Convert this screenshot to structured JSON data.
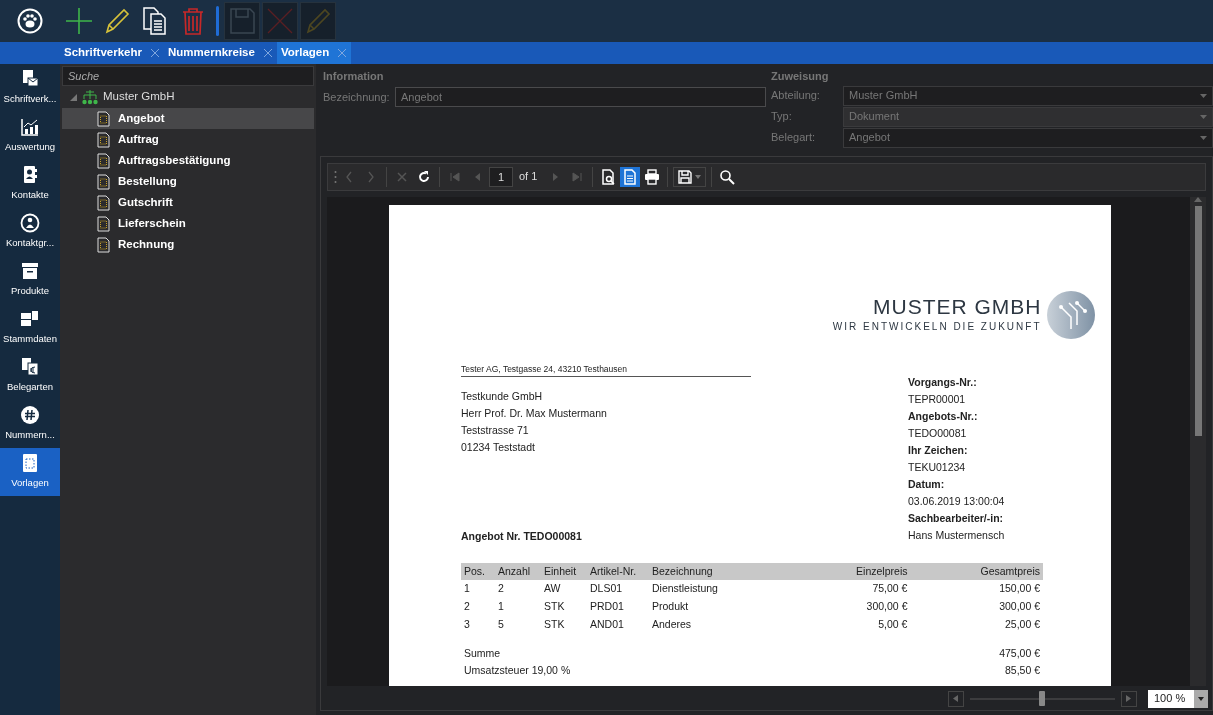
{
  "toolbar": {
    "items": [
      {
        "kind": "add",
        "disabled": false
      },
      {
        "kind": "edit",
        "disabled": false
      },
      {
        "kind": "copy",
        "disabled": false
      },
      {
        "kind": "delete",
        "disabled": false
      },
      {
        "kind": "separator"
      },
      {
        "kind": "save",
        "disabled": true
      },
      {
        "kind": "cancel",
        "disabled": true
      },
      {
        "kind": "edit",
        "disabled": true
      }
    ]
  },
  "tabs": [
    {
      "label": "Schriftverkehr",
      "selected": false
    },
    {
      "label": "Nummernkreise",
      "selected": false
    },
    {
      "label": "Vorlagen",
      "selected": true
    }
  ],
  "sidebar": {
    "items": [
      {
        "label": "Schriftverk...",
        "kind": "letters",
        "selected": false
      },
      {
        "label": "Auswertung",
        "kind": "chart",
        "selected": false
      },
      {
        "label": "Kontakte",
        "kind": "contact",
        "selected": false
      },
      {
        "label": "Kontaktgr...",
        "kind": "group",
        "selected": false
      },
      {
        "label": "Produkte",
        "kind": "box",
        "selected": false
      },
      {
        "label": "Stammdaten",
        "kind": "masterdata",
        "selected": false
      },
      {
        "label": "Belegarten",
        "kind": "doctypes",
        "selected": false
      },
      {
        "label": "Nummern...",
        "kind": "hash",
        "selected": false
      },
      {
        "label": "Vorlagen",
        "kind": "template",
        "selected": true
      }
    ]
  },
  "tree": {
    "search": {
      "placeholder": "Suche"
    },
    "items": [
      {
        "label": "Muster GmbH",
        "expanded": true,
        "selected": false,
        "children": [
          {
            "label": "Angebot",
            "selected": true
          },
          {
            "label": "Auftrag",
            "selected": false
          },
          {
            "label": "Auftragsbestätigung",
            "selected": false
          },
          {
            "label": "Bestellung",
            "selected": false
          },
          {
            "label": "Gutschrift",
            "selected": false
          },
          {
            "label": "Lieferschein",
            "selected": false
          },
          {
            "label": "Rechnung",
            "selected": false
          }
        ]
      }
    ]
  },
  "information": {
    "title": "Information",
    "fields": [
      {
        "label": "Bezeichnung:",
        "value": "Angebot"
      }
    ]
  },
  "assignment": {
    "title": "Zuweisung",
    "fields": [
      {
        "label": "Abteilung:",
        "value": "Muster GmbH"
      },
      {
        "label": "Typ:",
        "value": "Dokument"
      },
      {
        "label": "Belegart:",
        "value": "Angebot"
      }
    ]
  },
  "viewer": {
    "toolbar": [
      {
        "kind": "back",
        "disabled": true,
        "selected": false
      },
      {
        "kind": "forward",
        "disabled": true,
        "selected": false
      },
      {
        "kind": "sep"
      },
      {
        "kind": "stop",
        "disabled": true,
        "selected": false
      },
      {
        "kind": "refresh",
        "disabled": false,
        "selected": false
      },
      {
        "kind": "sep"
      },
      {
        "kind": "first",
        "disabled": true,
        "selected": false
      },
      {
        "kind": "prev",
        "disabled": true,
        "selected": false
      },
      {
        "kind": "page",
        "value": "1",
        "label": "of 1"
      },
      {
        "kind": "next",
        "disabled": true,
        "selected": false
      },
      {
        "kind": "last",
        "disabled": true,
        "selected": false
      },
      {
        "kind": "sep"
      },
      {
        "kind": "pagesetup",
        "disabled": false,
        "selected": false
      },
      {
        "kind": "printlayout",
        "disabled": false,
        "selected": true
      },
      {
        "kind": "print",
        "disabled": false,
        "selected": false
      },
      {
        "kind": "sep"
      },
      {
        "kind": "export",
        "disabled": false
      },
      {
        "kind": "sep"
      },
      {
        "kind": "find",
        "disabled": false,
        "selected": false
      }
    ],
    "document": {
      "company": "MUSTER GMBH",
      "tagline": "WIR ENTWICKELN DIE ZUKUNFT",
      "sender": "Tester AG, Testgasse 24, 43210 Testhausen",
      "recipient": [
        "Testkunde GmbH",
        "Herr Prof. Dr. Max Mustermann",
        "Teststrasse 71",
        "01234 Teststadt"
      ],
      "meta": [
        {
          "label": "Vorgangs-Nr.:",
          "value": "TEPR00001"
        },
        {
          "label": "Angebots-Nr.:",
          "value": "TEDO00081"
        },
        {
          "label": "Ihr Zeichen:",
          "value": "TEKU01234"
        },
        {
          "label": "Datum:",
          "value": "03.06.2019 13:00:04"
        },
        {
          "label": "Sachbearbeiter/-in:",
          "value": "Hans Mustermensch"
        }
      ],
      "title": "Angebot Nr. TEDO00081",
      "table": {
        "columns": [
          "Pos.",
          "Anzahl",
          "Einheit",
          "Artikel-Nr.",
          "Bezeichnung",
          "Einzelpreis",
          "Gesamtpreis"
        ],
        "rows": [
          [
            "1",
            "2",
            "AW",
            "DLS01",
            "Dienstleistung",
            "75,00 €",
            "150,00 €"
          ],
          [
            "2",
            "1",
            "STK",
            "PRD01",
            "Produkt",
            "300,00 €",
            "300,00 €"
          ],
          [
            "3",
            "5",
            "STK",
            "AND01",
            "Anderes",
            "5,00 €",
            "25,00 €"
          ]
        ]
      },
      "totals": [
        {
          "label": "Summe",
          "value": "475,00 €"
        },
        {
          "label": "Umsatzsteuer 19,00 %",
          "value": "85,50 €"
        }
      ]
    },
    "zoom": {
      "level": 0.5,
      "value": "100 %"
    }
  }
}
